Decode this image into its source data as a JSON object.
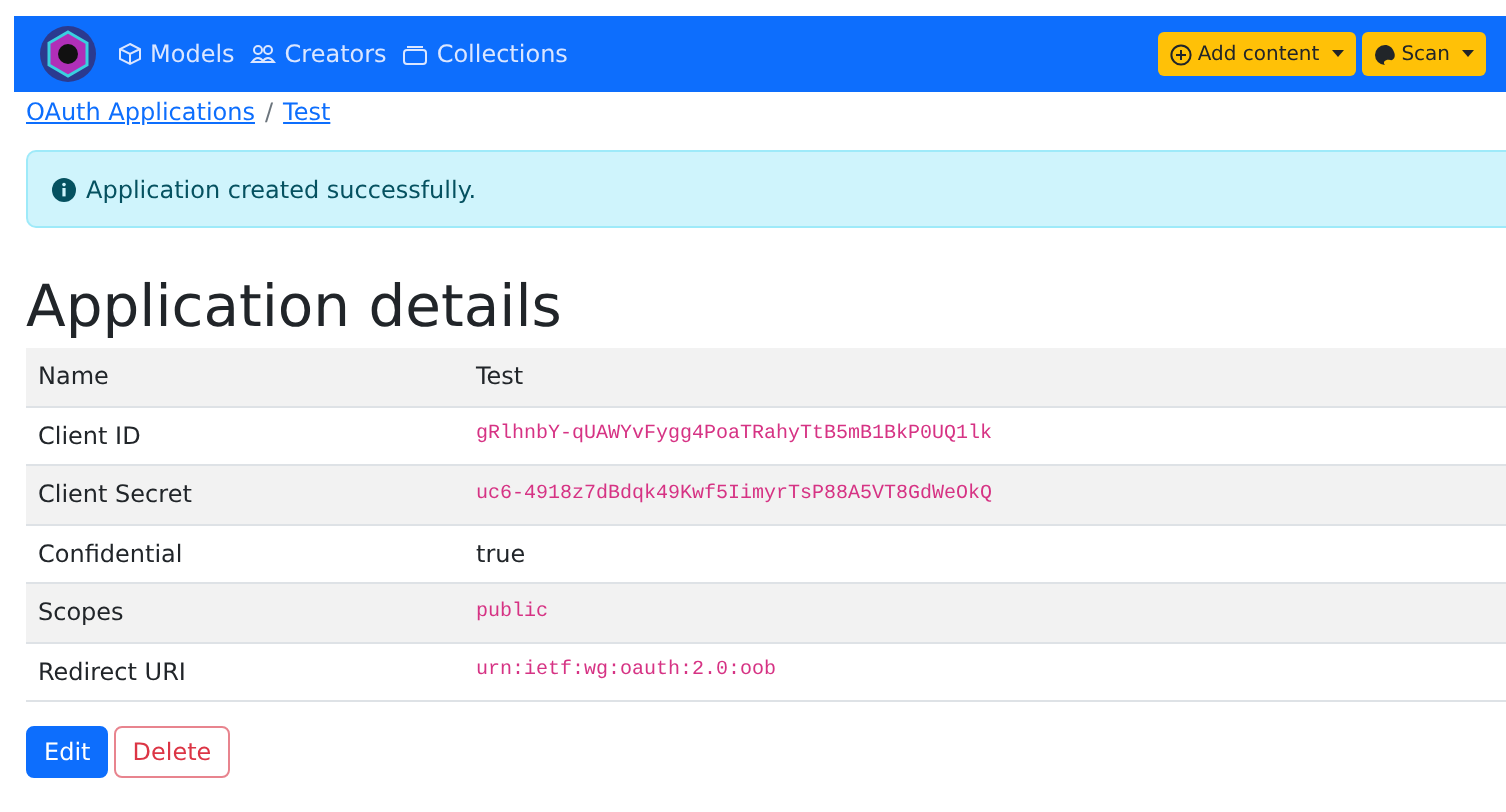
{
  "navbar": {
    "links": [
      {
        "label": "Models"
      },
      {
        "label": "Creators"
      },
      {
        "label": "Collections"
      }
    ],
    "actions": [
      {
        "label": "Add content"
      },
      {
        "label": "Scan"
      }
    ]
  },
  "breadcrumb": {
    "links": [
      "OAuth Applications",
      "Test"
    ],
    "separator": "/"
  },
  "alert": {
    "message": "Application created successfully."
  },
  "heading": "Application details",
  "table": {
    "rows": [
      {
        "label": "Name",
        "value": "Test",
        "kind": "text"
      },
      {
        "label": "Client ID",
        "value": "gRlhnbY-qUAWYvFygg4PoaTRahyTtB5mB1BkP0UQ1lk",
        "kind": "code"
      },
      {
        "label": "Client Secret",
        "value": "uc6-4918z7dBdqk49Kwf5IimyrTsP88A5VT8GdWeOkQ",
        "kind": "code"
      },
      {
        "label": "Confidential",
        "value": "true",
        "kind": "text"
      },
      {
        "label": "Scopes",
        "value": "public",
        "kind": "code"
      },
      {
        "label": "Redirect URI",
        "value": "urn:ietf:wg:oauth:2.0:oob",
        "kind": "code"
      }
    ]
  },
  "buttons": [
    {
      "label": "Edit",
      "kind": "primary"
    },
    {
      "label": "Delete",
      "kind": "danger"
    }
  ]
}
